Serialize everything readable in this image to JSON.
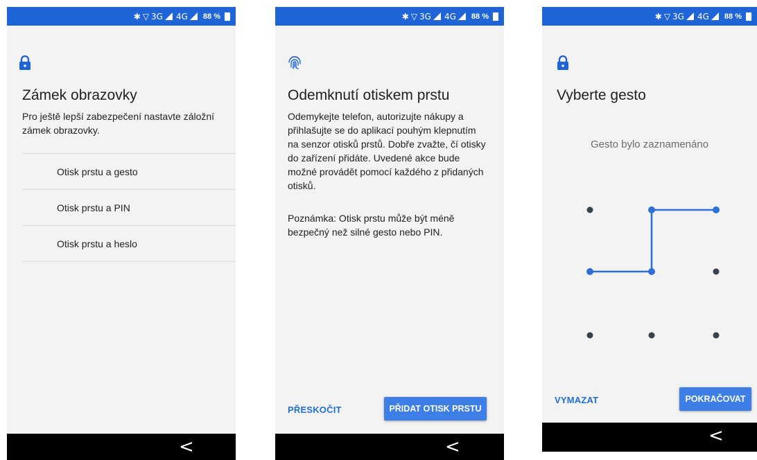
{
  "status_bar": {
    "network": "3G",
    "network2": "4G",
    "battery": "88 %"
  },
  "screen1": {
    "title": "Zámek obrazovky",
    "description": "Pro ještě lepší zabezpečení nastavte záložní zámek obrazovky.",
    "options": [
      "Otisk prstu a gesto",
      "Otisk prstu a PIN",
      "Otisk prstu a heslo"
    ]
  },
  "screen2": {
    "title": "Odemknutí otiskem prstu",
    "description": "Odemykejte telefon, autorizujte nákupy a přihlašujte se do aplikací pouhým klepnutím na senzor otisků prstů. Dobře zvažte, čí otisky do zařízení přidáte. Uvedené akce bude možné provádět pomocí každého z přidaných otisků.",
    "note": "Poznámka: Otisk prstu může být méně bezpečný než silné gesto nebo PIN.",
    "skip_label": "PŘESKOČIT",
    "add_label": "PŘIDAT OTISK PRSTU"
  },
  "screen3": {
    "title": "Vyberte gesto",
    "status": "Gesto bylo zaznamenáno",
    "clear_label": "VYMAZAT",
    "continue_label": "POKRAČOVAT"
  },
  "colors": {
    "accent": "#1f65d8",
    "pattern": "#2f6fd8",
    "dot": "#37424a"
  }
}
